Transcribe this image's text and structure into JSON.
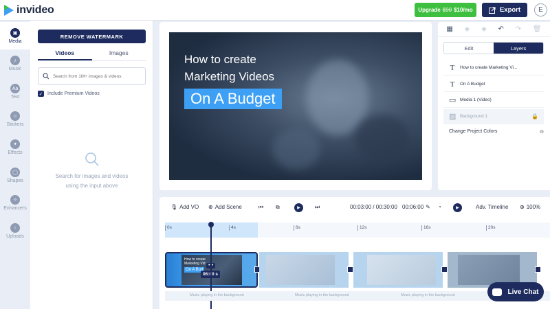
{
  "app": {
    "logo_text": "invideo",
    "upgrade": {
      "label": "Upgrade",
      "old_price": "$90",
      "price": "$10/mo"
    },
    "export_label": "Export",
    "avatar_initial": "E"
  },
  "rail": [
    {
      "label": "Media",
      "icon": "image-icon"
    },
    {
      "label": "Music",
      "icon": "music-icon"
    },
    {
      "label": "Text",
      "icon": "text-icon"
    },
    {
      "label": "Stickers",
      "icon": "sticker-icon"
    },
    {
      "label": "Effects",
      "icon": "effects-icon"
    },
    {
      "label": "Shapes",
      "icon": "shapes-icon"
    },
    {
      "label": "Enhancers",
      "icon": "enhancers-icon"
    },
    {
      "label": "Uploads",
      "icon": "upload-icon"
    }
  ],
  "media_panel": {
    "remove_watermark": "REMOVE WATERMARK",
    "tabs": [
      "Videos",
      "Images"
    ],
    "active_tab": "Videos",
    "search_placeholder": "Search from 1M+ images & videos",
    "premium_label": "Include Premium Videos",
    "premium_checked": true,
    "empty_line1": "Search for images and videos",
    "empty_line2": "using the input above"
  },
  "preview": {
    "line1": "How to create",
    "line2": "Marketing Videos",
    "line3": "On A Budget",
    "highlight_color": "#3ea0f5"
  },
  "right_panel": {
    "tabs": [
      "Edit",
      "Layers"
    ],
    "active_tab": "Layers",
    "layers": [
      {
        "label": "How to create Marketing Vi...",
        "icon": "text-layer-icon"
      },
      {
        "label": "On A Budget",
        "icon": "text-layer-icon"
      },
      {
        "label": "Media 1 (Video)",
        "icon": "media-layer-icon"
      },
      {
        "label": "Background 1",
        "icon": "image-layer-icon"
      }
    ],
    "project_colors": "Change Project Colors"
  },
  "timeline": {
    "add_vo": "Add VO",
    "add_scene": "Add Scene",
    "time_current": "00:03:00 / 00:30:00",
    "scene_duration": "00:06:00",
    "adv_timeline": "Adv. Timeline",
    "zoom": "100%",
    "ticks": [
      "0s",
      "4s",
      "8s",
      "12s",
      "16s",
      "20s"
    ],
    "clip_duration": "06:00 s",
    "clip_more": "•••",
    "clip_text": [
      "How to create",
      "Marketing Vid",
      "On A Bud"
    ],
    "music_label": "Music playing in the background"
  },
  "livechat_label": "Live Chat",
  "colors": {
    "brand_navy": "#1d2b5e",
    "upgrade_green": "#3fbf3f",
    "accent_blue": "#3ea0f5"
  }
}
